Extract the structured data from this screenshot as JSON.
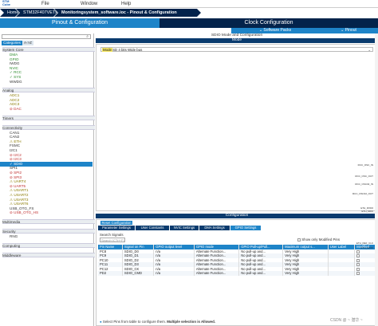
{
  "menubar": {
    "items": [
      "File",
      "Window",
      "Help"
    ]
  },
  "breadcrumbs": [
    "Home",
    "STM32F407VETx",
    "Monitoringsystem_software.ioc - Pinout & Configuration"
  ],
  "tabs": {
    "pinout": "Pinout & Configuration",
    "clock": "Clock Configuration"
  },
  "subtabs": {
    "software_packs": "⌄ Software Packs",
    "pinout": "⌄ Pinout"
  },
  "left_panel": {
    "search_placeholder": "",
    "tab_categories": "Categories",
    "tab_az": "A->Z",
    "sections": [
      {
        "label": "System Core",
        "items": [
          {
            "label": "DMA",
            "state": "ok"
          },
          {
            "label": "GPIO",
            "state": "ok"
          },
          {
            "label": "IWDG",
            "state": "none"
          },
          {
            "label": "NVIC",
            "state": "ok"
          },
          {
            "label": "✓ RCC",
            "state": "ok"
          },
          {
            "label": "✓ SYS",
            "state": "ok"
          },
          {
            "label": "WWDG",
            "state": "none"
          }
        ]
      },
      {
        "label": "Analog",
        "items": [
          {
            "label": "ADC1",
            "state": "warn"
          },
          {
            "label": "ADC2",
            "state": "warn"
          },
          {
            "label": "ADC3",
            "state": "warn"
          },
          {
            "label": "⊘ DAC",
            "state": "err"
          }
        ]
      },
      {
        "label": "Timers",
        "items": []
      },
      {
        "label": "Connectivity",
        "items": [
          {
            "label": "CAN1",
            "state": "none"
          },
          {
            "label": "CAN2",
            "state": "none"
          },
          {
            "label": "⚠ ETH",
            "state": "warn"
          },
          {
            "label": "FSMC",
            "state": "none"
          },
          {
            "label": "I2C1",
            "state": "none"
          },
          {
            "label": "⊘ I2C2",
            "state": "err"
          },
          {
            "label": "⊘ I2C3",
            "state": "err"
          },
          {
            "label": "✓ SDIO",
            "state": "sel"
          },
          {
            "label": "SPI1",
            "state": "none"
          },
          {
            "label": "⊘ SPI2",
            "state": "err"
          },
          {
            "label": "⊘ SPI3",
            "state": "err"
          },
          {
            "label": "⚠ UART4",
            "state": "warn"
          },
          {
            "label": "⊘ UART5",
            "state": "err"
          },
          {
            "label": "⚠ USART1",
            "state": "warn"
          },
          {
            "label": "⚠ USART2",
            "state": "warn"
          },
          {
            "label": "⚠ USART3",
            "state": "warn"
          },
          {
            "label": "⚠ USART6",
            "state": "warn"
          },
          {
            "label": "USB_OTG_FS",
            "state": "none"
          },
          {
            "label": "⊘ USB_OTG_HS",
            "state": "err"
          }
        ]
      },
      {
        "label": "Multimedia",
        "items": []
      },
      {
        "label": "Security",
        "items": [
          {
            "label": "RNG",
            "state": "none"
          }
        ]
      },
      {
        "label": "Computing",
        "items": []
      },
      {
        "label": "Middleware",
        "items": []
      }
    ]
  },
  "center": {
    "title": "SDIO Mode and Configuration",
    "mode_header": "Mode",
    "mode_label": "Mode",
    "mode_value": "SD 4 bits Wide bus",
    "config_header": "Configuration",
    "reset_label": "Reset Configuration",
    "config_tabs": [
      "Parameter Settings",
      "User Constants",
      "NVIC Settings",
      "DMA Settings",
      "GPIO Settings"
    ],
    "search_label": "Search Signals",
    "search_placeholder": "Search (CTrl+F)",
    "show_modified": "Show only Modified Pins",
    "columns": [
      "Pin Name",
      "Signal on Pin",
      "GPIO output level",
      "GPIO mode",
      "GPIO Pull-up/Pull...",
      "Maximum output s...",
      "User Label",
      "Modified"
    ],
    "rows": [
      [
        "PC8",
        "SDIO_D0",
        "n/a",
        "Alternate Function...",
        "No pull-up and...",
        "Very High",
        "",
        ""
      ],
      [
        "PC9",
        "SDIO_D1",
        "n/a",
        "Alternate Function...",
        "No pull-up and...",
        "Very High",
        "",
        ""
      ],
      [
        "PC10",
        "SDIO_D2",
        "n/a",
        "Alternate Function...",
        "No pull-up and...",
        "Very High",
        "",
        ""
      ],
      [
        "PC11",
        "SDIO_D3",
        "n/a",
        "Alternate Function...",
        "No pull-up and...",
        "Very High",
        "",
        ""
      ],
      [
        "PC12",
        "SDIO_CK",
        "n/a",
        "Alternate Function...",
        "No pull-up and...",
        "Very High",
        "",
        ""
      ],
      [
        "PD2",
        "SDIO_CMD",
        "n/a",
        "Alternate Function...",
        "No pull-up and...",
        "Very High",
        "",
        ""
      ]
    ],
    "hint_bold": "Multiple selection is Allowed.",
    "hint_prefix": "Select Pins from table to configure them. "
  },
  "right_labels": [
    "RCC_OSC_IN",
    "RCC_OSC_OUT",
    "RCC_OSC32_IN",
    "RCC_OSC32_OUT",
    "ETH_RXD0",
    "ETH_MDC",
    "ETH_REF_CLK",
    "ETH_MDIO"
  ],
  "watermark": "CSDN @ ~ 潜华 ~",
  "colors": {
    "navy": "#03234b",
    "blue": "#1e84c8",
    "tab_active": "#1e84c8"
  }
}
